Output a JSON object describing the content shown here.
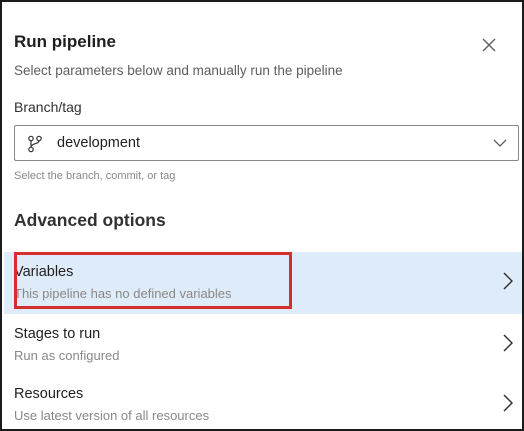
{
  "dialog": {
    "title": "Run pipeline",
    "subtitle": "Select parameters below and manually run the pipeline",
    "close_icon": "close-icon"
  },
  "branch": {
    "label": "Branch/tag",
    "value": "development",
    "helper": "Select the branch, commit, or tag",
    "icon": "git-branch-icon"
  },
  "advanced": {
    "heading": "Advanced options",
    "items": [
      {
        "title": "Variables",
        "subtitle": "This pipeline has no defined variables",
        "selected": true
      },
      {
        "title": "Stages to run",
        "subtitle": "Run as configured",
        "selected": false
      },
      {
        "title": "Resources",
        "subtitle": "Use latest version of all resources",
        "selected": false
      }
    ]
  },
  "colors": {
    "selected_row_bg": "#deecf9",
    "highlight_border": "#d32f2f"
  }
}
